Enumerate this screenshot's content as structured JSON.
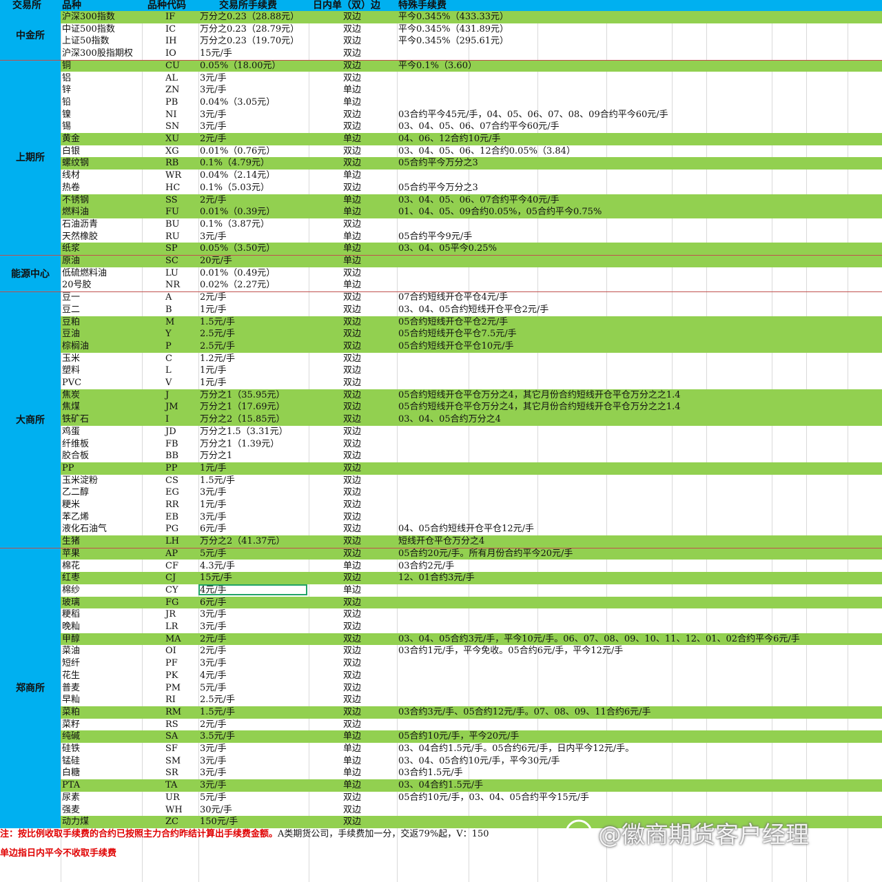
{
  "header": {
    "exchange": "交易所",
    "name": "品种",
    "code": "品种代码",
    "fee": "交易所手续费",
    "side": "日内单（双）边",
    "special": "特殊手续费"
  },
  "exchanges": [
    {
      "name": "中金所",
      "rows": [
        {
          "name": "沪深300指数",
          "code": "IF",
          "fee": "万分之0.23（28.88元）",
          "side": "双边",
          "special": "平今0.345%（433.33元）",
          "green": true
        },
        {
          "name": "中证500指数",
          "code": "IC",
          "fee": "万分之0.23（28.79元）",
          "side": "双边",
          "special": "平今0.345%（431.89元）",
          "green": false
        },
        {
          "name": "上证50指数",
          "code": "IH",
          "fee": "万分之0.23（19.70元）",
          "side": "双边",
          "special": "平今0.345%（295.61元）",
          "green": false
        },
        {
          "name": "沪深300股指期权",
          "code": "IO",
          "fee": "15元/手",
          "side": "双边",
          "special": "",
          "green": false
        }
      ]
    },
    {
      "name": "上期所",
      "rows": [
        {
          "name": "铜",
          "code": "CU",
          "fee": "0.05%（18.00元）",
          "side": "双边",
          "special": "平今0.1%（3.60）",
          "green": true
        },
        {
          "name": "铝",
          "code": "AL",
          "fee": "3元/手",
          "side": "双边",
          "special": "",
          "green": false
        },
        {
          "name": "锌",
          "code": "ZN",
          "fee": "3元/手",
          "side": "单边",
          "special": "",
          "green": false
        },
        {
          "name": "铅",
          "code": "PB",
          "fee": "0.04%（3.05元）",
          "side": "单边",
          "special": "",
          "green": false
        },
        {
          "name": "镍",
          "code": "NI",
          "fee": "3元/手",
          "side": "双边",
          "special": "03合约平今45元/手，04、05、06、07、08、09合约平今60元/手",
          "green": false
        },
        {
          "name": "锡",
          "code": "SN",
          "fee": "3元/手",
          "side": "双边",
          "special": "03、04、05、06、07合约平今60元/手",
          "green": false
        },
        {
          "name": "黄金",
          "code": "XU",
          "fee": "2元/手",
          "side": "单边",
          "special": "04、06、12合约10元/手",
          "green": true
        },
        {
          "name": "白银",
          "code": "XG",
          "fee": "0.01%（0.76元）",
          "side": "双边",
          "special": "03、04、05、06、12合约0.05%（3.84）",
          "green": false
        },
        {
          "name": "螺纹钢",
          "code": "RB",
          "fee": "0.1%（4.79元）",
          "side": "双边",
          "special": "05合约平今万分之3",
          "green": true
        },
        {
          "name": "线材",
          "code": "WR",
          "fee": "0.04%（2.14元）",
          "side": "单边",
          "special": "",
          "green": false
        },
        {
          "name": "热卷",
          "code": "HC",
          "fee": "0.1%（5.03元）",
          "side": "双边",
          "special": "05合约平今万分之3",
          "green": false
        },
        {
          "name": "不锈钢",
          "code": "SS",
          "fee": "2元/手",
          "side": "单边",
          "special": "03、04、05、06、07合约平今40元/手",
          "green": true
        },
        {
          "name": "燃料油",
          "code": "FU",
          "fee": "0.01%（0.39元）",
          "side": "单边",
          "special": "01、04、05、09合约0.05%，05合约平今0.75%",
          "green": true
        },
        {
          "name": "石油沥青",
          "code": "BU",
          "fee": "0.1%（3.87元）",
          "side": "双边",
          "special": "",
          "green": false
        },
        {
          "name": "天然橡胶",
          "code": "RU",
          "fee": "3元/手",
          "side": "单边",
          "special": "05合约平今9元/手",
          "green": false
        },
        {
          "name": "纸浆",
          "code": "SP",
          "fee": "0.05%（3.50元）",
          "side": "单边",
          "special": "03、04、05平今0.25%",
          "green": true
        }
      ]
    },
    {
      "name": "能源中心",
      "rows": [
        {
          "name": "原油",
          "code": "SC",
          "fee": "20元/手",
          "side": "单边",
          "special": "",
          "green": true
        },
        {
          "name": "低硫燃料油",
          "code": "LU",
          "fee": "0.01%（0.49元）",
          "side": "双边",
          "special": "",
          "green": false
        },
        {
          "name": "20号胶",
          "code": "NR",
          "fee": "0.02%（2.27元）",
          "side": "单边",
          "special": "",
          "green": false
        }
      ]
    },
    {
      "name": "大商所",
      "rows": [
        {
          "name": "豆一",
          "code": "A",
          "fee": "2元/手",
          "side": "双边",
          "special": "07合约短线开仓平仓4元/手",
          "green": false
        },
        {
          "name": "豆二",
          "code": "B",
          "fee": "1元/手",
          "side": "双边",
          "special": "03、04、05合约短线开仓平仓2元/手",
          "green": false
        },
        {
          "name": "豆粕",
          "code": "M",
          "fee": "1.5元/手",
          "side": "双边",
          "special": "05合约短线开仓平仓2元/手",
          "green": true
        },
        {
          "name": "豆油",
          "code": "Y",
          "fee": "2.5元/手",
          "side": "双边",
          "special": "05合约短线开仓平仓7.5元/手",
          "green": true
        },
        {
          "name": "棕榈油",
          "code": "P",
          "fee": "2.5元/手",
          "side": "双边",
          "special": "05合约短线开仓平仓10元/手",
          "green": true
        },
        {
          "name": "玉米",
          "code": "C",
          "fee": "1.2元/手",
          "side": "双边",
          "special": "",
          "green": false
        },
        {
          "name": "塑料",
          "code": "L",
          "fee": "1元/手",
          "side": "双边",
          "special": "",
          "green": false
        },
        {
          "name": "PVC",
          "code": "V",
          "fee": "1元/手",
          "side": "双边",
          "special": "",
          "green": false
        },
        {
          "name": "焦炭",
          "code": "J",
          "fee": "万分之1（35.95元）",
          "side": "双边",
          "special": "05合约短线开仓平仓万分之4，其它月份合约短线开仓平仓万分之之1.4",
          "green": true
        },
        {
          "name": "焦煤",
          "code": "JM",
          "fee": "万分之1（17.69元）",
          "side": "双边",
          "special": "05合约短线开仓平仓万分之4，其它月份合约短线开仓平仓万分之之1.4",
          "green": true
        },
        {
          "name": "铁矿石",
          "code": "I",
          "fee": "万分之2（15.85元）",
          "side": "双边",
          "special": "03、04、05合约万分之4",
          "green": true
        },
        {
          "name": "鸡蛋",
          "code": "JD",
          "fee": "万分之1.5（3.31元）",
          "side": "双边",
          "special": "",
          "green": false
        },
        {
          "name": "纤维板",
          "code": "FB",
          "fee": "万分之1（1.39元）",
          "side": "双边",
          "special": "",
          "green": false
        },
        {
          "name": "胶合板",
          "code": "BB",
          "fee": "万分之1",
          "side": "双边",
          "special": "",
          "green": false
        },
        {
          "name": "PP",
          "code": "PP",
          "fee": "1元/手",
          "side": "双边",
          "special": "",
          "green": true
        },
        {
          "name": "玉米淀粉",
          "code": "CS",
          "fee": "1.5元/手",
          "side": "双边",
          "special": "",
          "green": false
        },
        {
          "name": "乙二醇",
          "code": "EG",
          "fee": "3元/手",
          "side": "双边",
          "special": "",
          "green": false
        },
        {
          "name": "粳米",
          "code": "RR",
          "fee": "1元/手",
          "side": "双边",
          "special": "",
          "green": false
        },
        {
          "name": "苯乙烯",
          "code": "EB",
          "fee": "3元/手",
          "side": "双边",
          "special": "",
          "green": false
        },
        {
          "name": "液化石油气",
          "code": "PG",
          "fee": "6元/手",
          "side": "双边",
          "special": "04、05合约短线开仓平仓12元/手",
          "green": false
        },
        {
          "name": "生猪",
          "code": "LH",
          "fee": "万分之2（41.37元）",
          "side": "双边",
          "special": "短线开仓平仓万分之4",
          "green": true
        }
      ]
    },
    {
      "name": "郑商所",
      "rows": [
        {
          "name": "苹果",
          "code": "AP",
          "fee": "5元/手",
          "side": "双边",
          "special": "05合约20元/手。所有月份合约平今20元/手",
          "green": true
        },
        {
          "name": "棉花",
          "code": "CF",
          "fee": "4.3元/手",
          "side": "单边",
          "special": "03合约2元/手",
          "green": false
        },
        {
          "name": "红枣",
          "code": "CJ",
          "fee": "15元/手",
          "side": "双边",
          "special": "12、01合约3元/手",
          "green": true
        },
        {
          "name": "棉纱",
          "code": "CY",
          "fee": "4元/手",
          "side": "单边",
          "special": "",
          "green": false,
          "selected": true
        },
        {
          "name": "玻璃",
          "code": "FG",
          "fee": "6元/手",
          "side": "双边",
          "special": "",
          "green": true
        },
        {
          "name": "粳稻",
          "code": "JR",
          "fee": "3元/手",
          "side": "双边",
          "special": "",
          "green": false
        },
        {
          "name": "晚籼",
          "code": "LR",
          "fee": "3元/手",
          "side": "双边",
          "special": "",
          "green": false
        },
        {
          "name": "甲醇",
          "code": "MA",
          "fee": "2元/手",
          "side": "双边",
          "special": "03、04、05合约3元/手，平今10元/手。06、07、08、09、10、11、12、01、02合约平今6元/手",
          "green": true
        },
        {
          "name": "菜油",
          "code": "OI",
          "fee": "2元/手",
          "side": "双边",
          "special": "03合约1元/手，平今免收。05合约6元/手，平今12元/手",
          "green": false
        },
        {
          "name": "短纤",
          "code": "PF",
          "fee": "3元/手",
          "side": "双边",
          "special": "",
          "green": false
        },
        {
          "name": "花生",
          "code": "PK",
          "fee": "4元/手",
          "side": "双边",
          "special": "",
          "green": false
        },
        {
          "name": "普麦",
          "code": "PM",
          "fee": "5元/手",
          "side": "双边",
          "special": "",
          "green": false
        },
        {
          "name": "早籼",
          "code": "RI",
          "fee": "2.5元/手",
          "side": "双边",
          "special": "",
          "green": false
        },
        {
          "name": "菜粕",
          "code": "RM",
          "fee": "1.5元/手",
          "side": "双边",
          "special": "03合约3元/手、05合约12元/手。07、08、09、11合约6元/手",
          "green": true
        },
        {
          "name": "菜籽",
          "code": "RS",
          "fee": "2元/手",
          "side": "双边",
          "special": "",
          "green": false
        },
        {
          "name": "纯碱",
          "code": "SA",
          "fee": "3.5元/手",
          "side": "单边",
          "special": "05合约10元/手，平今20元/手",
          "green": true
        },
        {
          "name": "硅铁",
          "code": "SF",
          "fee": "3元/手",
          "side": "单边",
          "special": "03、04合约1.5元/手。05合约6元/手，日内平今12元/手。",
          "green": false
        },
        {
          "name": "锰硅",
          "code": "SM",
          "fee": "3元/手",
          "side": "单边",
          "special": "03、04、05合约10元/手，平今30元/手",
          "green": false
        },
        {
          "name": "白糖",
          "code": "SR",
          "fee": "3元/手",
          "side": "单边",
          "special": "03合约1.5元/手",
          "green": false
        },
        {
          "name": "PTA",
          "code": "TA",
          "fee": "3元/手",
          "side": "单边",
          "special": "03、04合约1.5元/手",
          "green": true
        },
        {
          "name": "尿素",
          "code": "UR",
          "fee": "5元/手",
          "side": "双边",
          "special": "05合约10元/手，03、04、05合约平今15元/手",
          "green": false
        },
        {
          "name": "强麦",
          "code": "WH",
          "fee": "30元/手",
          "side": "双边",
          "special": "",
          "green": false
        },
        {
          "name": "动力煤",
          "code": "ZC",
          "fee": "150元/手",
          "side": "双边",
          "special": "",
          "green": true
        }
      ]
    }
  ],
  "notes": {
    "note1_red": "注：按比例收取手续费的合约已按照主力合约昨结计算出手续费金额。",
    "note1_black": "A类期货公司，手续费加一分，交返79%起，V：150",
    "note2": "单边指日内平今不收取手续费"
  },
  "watermark": {
    "text": "@徽商期货客户经理",
    "icon": "chat-bubble-logo-icon"
  },
  "colors": {
    "header_blue": "#00b0f0",
    "row_green": "#92d050",
    "note_red": "#e00000",
    "separator": "#c0504d"
  }
}
